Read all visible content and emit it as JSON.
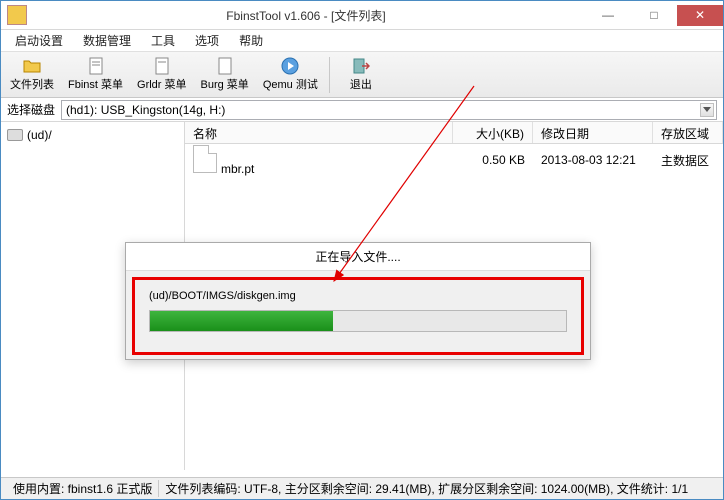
{
  "title": "FbinstTool v1.606 - [文件列表]",
  "menu": [
    "启动设置",
    "数据管理",
    "工具",
    "选项",
    "帮助"
  ],
  "toolbar": [
    {
      "label": "文件列表",
      "icon": "folder"
    },
    {
      "label": "Fbinst 菜单",
      "icon": "doc"
    },
    {
      "label": "Grldr 菜单",
      "icon": "doc"
    },
    {
      "label": "Burg 菜单",
      "icon": "doc"
    },
    {
      "label": "Qemu 测试",
      "icon": "play"
    },
    {
      "label": "退出",
      "icon": "exit"
    }
  ],
  "disk_label": "选择磁盘",
  "disk_combo": "(hd1): USB_Kingston(14g, H:)",
  "tree": {
    "root": "(ud)/"
  },
  "list_headers": {
    "name": "名称",
    "size": "大小(KB)",
    "date": "修改日期",
    "area": "存放区域"
  },
  "rows": [
    {
      "name": "mbr.pt",
      "size": "0.50 KB",
      "date": "2013-08-03 12:21",
      "area": "主数据区"
    }
  ],
  "dialog": {
    "title": "正在导入文件....",
    "path": "(ud)/BOOT/IMGS/diskgen.img"
  },
  "status": {
    "kernel": "使用内置: fbinst1.6 正式版",
    "rest": "文件列表编码: UTF-8, 主分区剩余空间:     29.41(MB),  扩展分区剩余空间:     1024.00(MB), 文件统计: 1/1"
  }
}
